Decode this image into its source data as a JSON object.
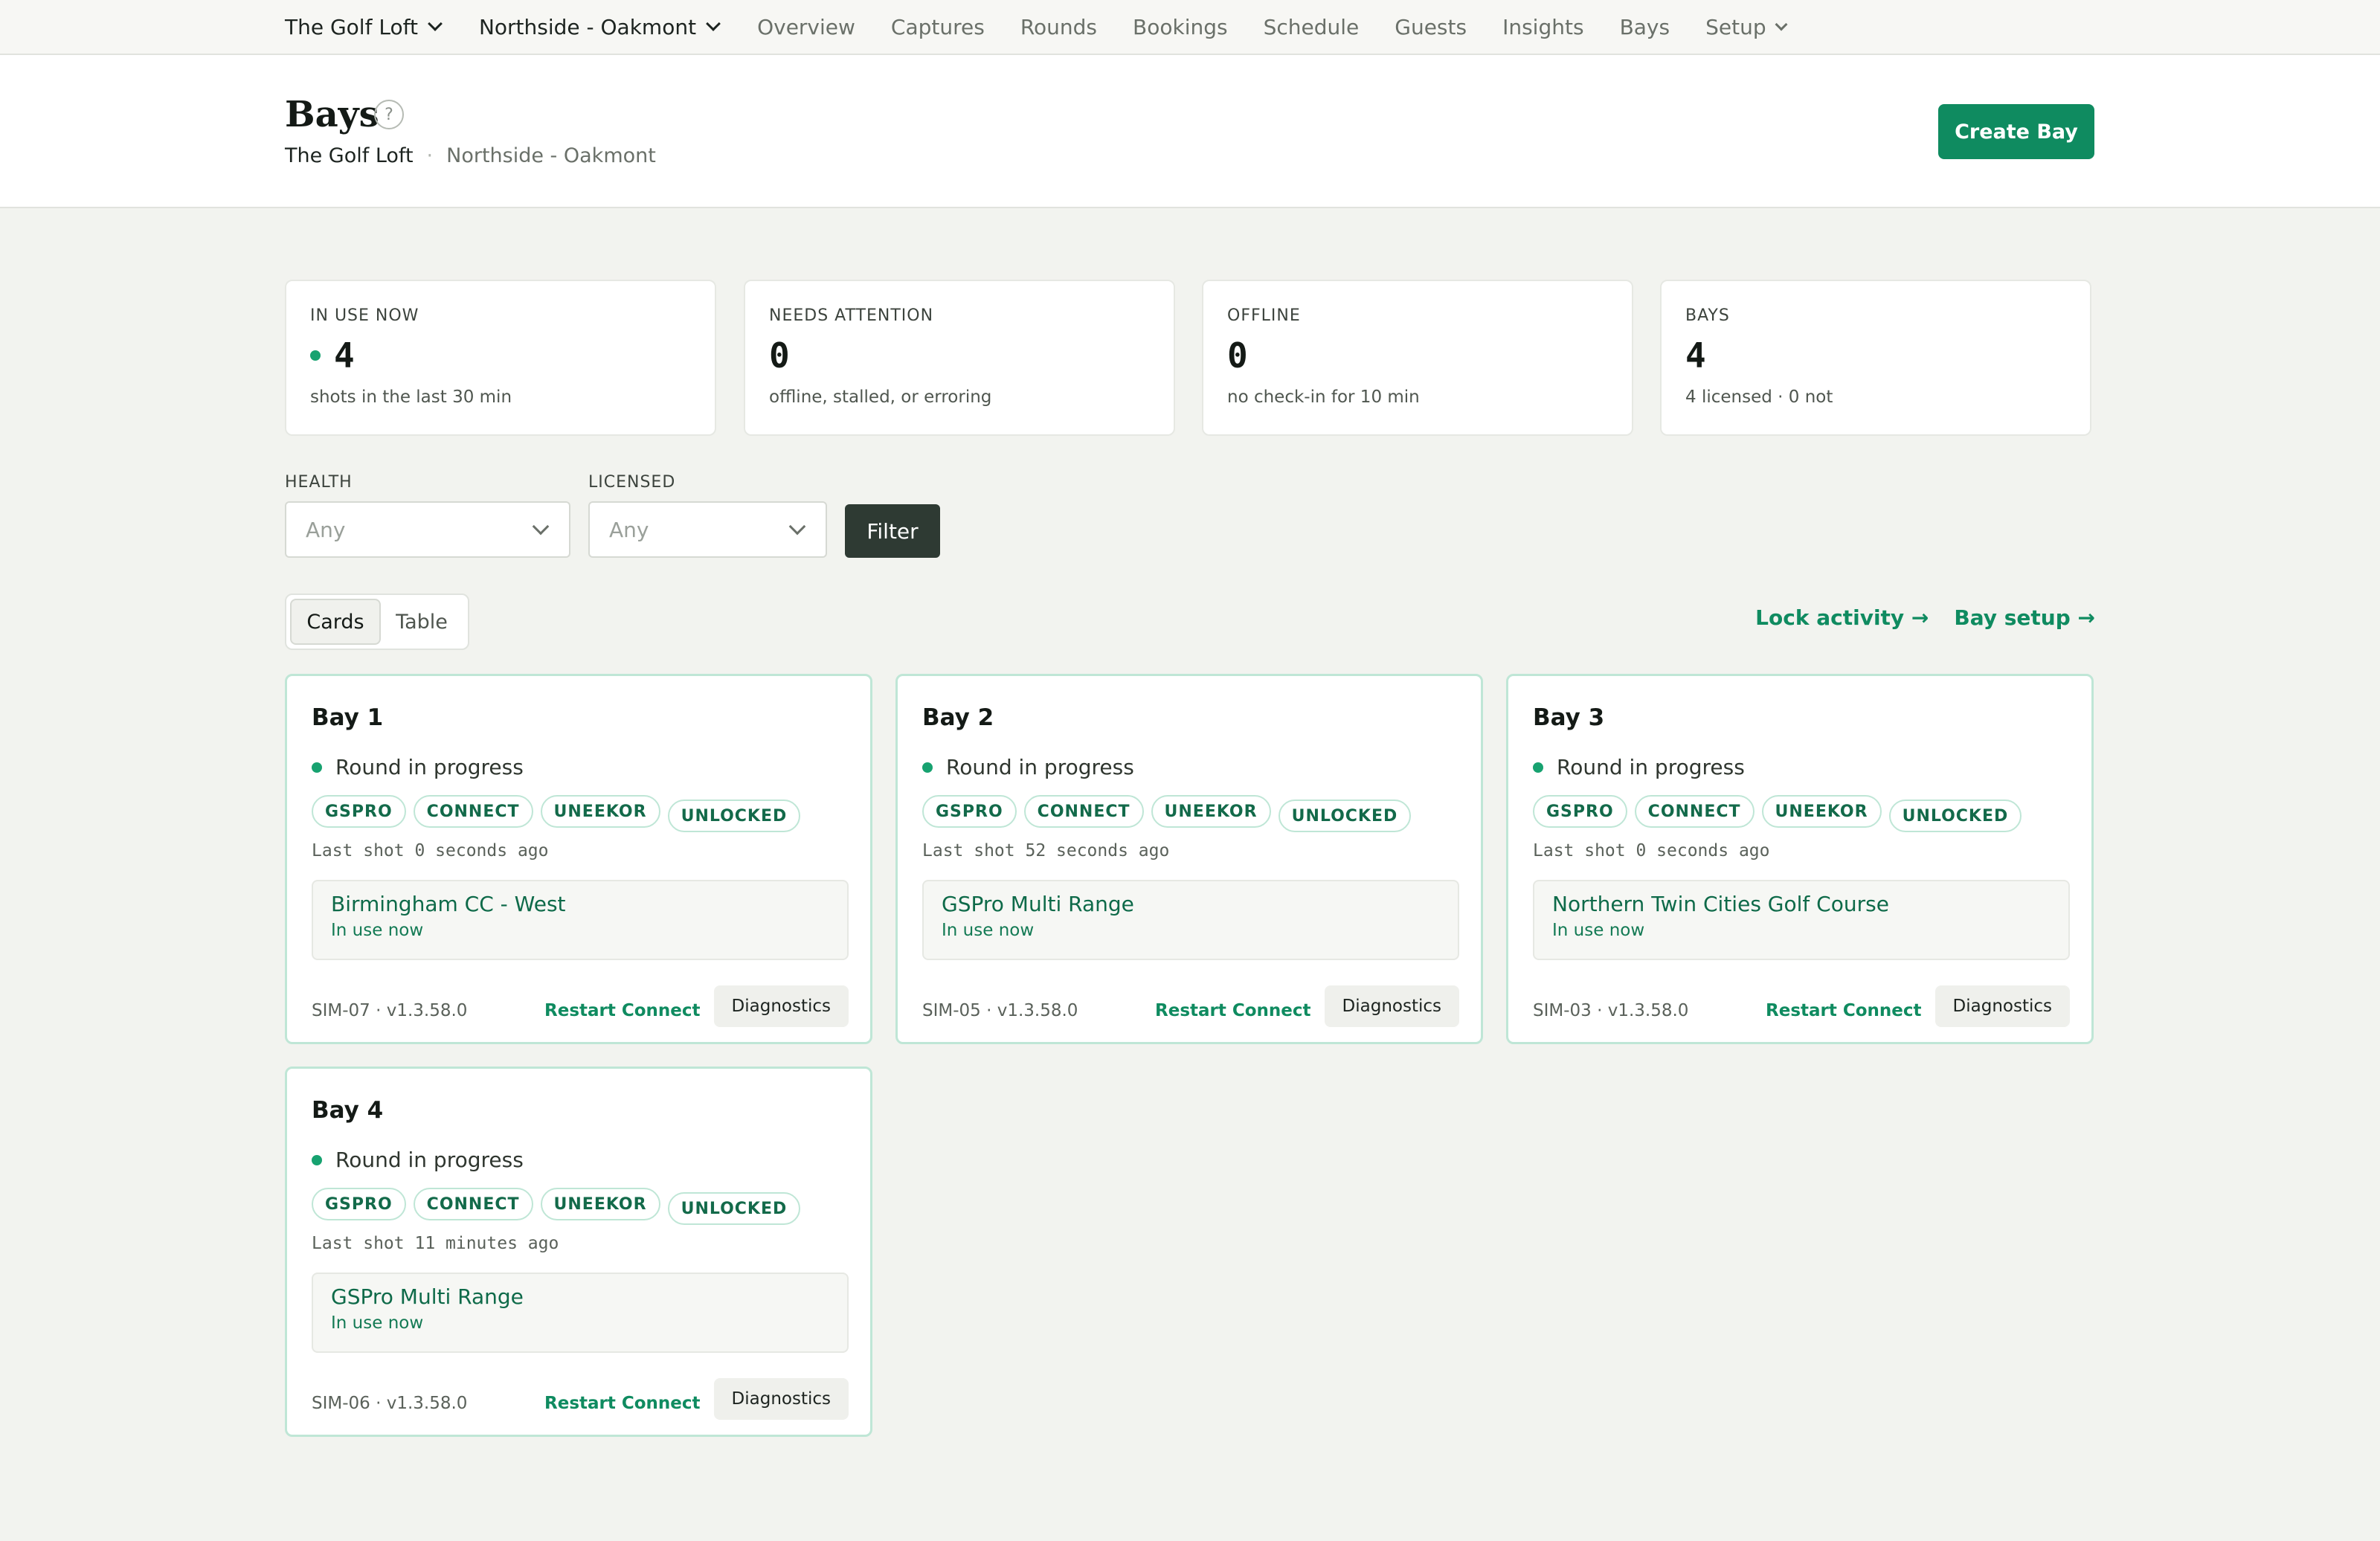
{
  "nav": {
    "org_select": "The Golf Loft",
    "location_select": "Northside - Oakmont",
    "links": [
      "Overview",
      "Captures",
      "Rounds",
      "Bookings",
      "Schedule",
      "Guests",
      "Insights",
      "Bays"
    ],
    "setup_label": "Setup"
  },
  "header": {
    "title": "Bays",
    "help_glyph": "?",
    "org": "The Golf Loft",
    "location": "Northside - Oakmont",
    "create_label": "Create Bay"
  },
  "stats": [
    {
      "label": "IN USE NOW",
      "value": "4",
      "sub": "shots in the last 30 min"
    },
    {
      "label": "NEEDS ATTENTION",
      "value": "0",
      "sub": "offline, stalled, or erroring"
    },
    {
      "label": "OFFLINE",
      "value": "0",
      "sub": "no check-in for 10 min"
    },
    {
      "label": "BAYS",
      "value": "4",
      "sub": "4 licensed · 0 not"
    }
  ],
  "filters": {
    "health_label": "HEALTH",
    "health_value": "Any",
    "licensed_label": "LICENSED",
    "licensed_value": "Any",
    "filter_button": "Filter"
  },
  "view_toggle": {
    "cards": "Cards",
    "table": "Table"
  },
  "links": {
    "lock_activity": "Lock activity →",
    "bay_setup": "Bay setup →"
  },
  "bays": [
    {
      "name": "Bay 1",
      "status": "Round in progress",
      "badges": [
        "GSPRO",
        "CONNECT",
        "UNEEKOR",
        "UNLOCKED"
      ],
      "last_shot": "Last shot 0 seconds ago",
      "course": "Birmingham CC - West",
      "in_use": "In use now",
      "sim": "SIM-07 · v1.3.58.0",
      "restart": "Restart Connect",
      "diagnostics": "Diagnostics"
    },
    {
      "name": "Bay 2",
      "status": "Round in progress",
      "badges": [
        "GSPRO",
        "CONNECT",
        "UNEEKOR",
        "UNLOCKED"
      ],
      "last_shot": "Last shot 52 seconds ago",
      "course": "GSPro Multi Range",
      "in_use": "In use now",
      "sim": "SIM-05 · v1.3.58.0",
      "restart": "Restart Connect",
      "diagnostics": "Diagnostics"
    },
    {
      "name": "Bay 3",
      "status": "Round in progress",
      "badges": [
        "GSPRO",
        "CONNECT",
        "UNEEKOR",
        "UNLOCKED"
      ],
      "last_shot": "Last shot 0 seconds ago",
      "course": "Northern Twin Cities Golf Course",
      "in_use": "In use now",
      "sim": "SIM-03 · v1.3.58.0",
      "restart": "Restart Connect",
      "diagnostics": "Diagnostics"
    },
    {
      "name": "Bay 4",
      "status": "Round in progress",
      "badges": [
        "GSPRO",
        "CONNECT",
        "UNEEKOR",
        "UNLOCKED"
      ],
      "last_shot": "Last shot 11 minutes ago",
      "course": "GSPro Multi Range",
      "in_use": "In use now",
      "sim": "SIM-06 · v1.3.58.0",
      "restart": "Restart Connect",
      "diagnostics": "Diagnostics"
    }
  ],
  "colors": {
    "accent": "#0f8b60",
    "status_dot": "#17a270",
    "dark_button": "#2e3a33",
    "page_bg": "#f2f3ef"
  }
}
